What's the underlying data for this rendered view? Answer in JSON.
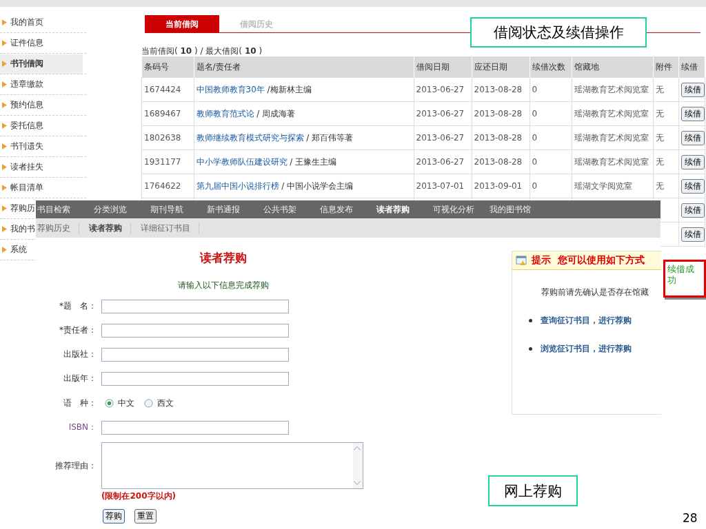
{
  "sidebar": {
    "items": [
      {
        "label": "我的首页",
        "selected": false
      },
      {
        "label": "证件信息",
        "selected": false
      },
      {
        "label": "书刊借阅",
        "selected": true
      },
      {
        "label": "违章缴款",
        "selected": false
      },
      {
        "label": "预约信息",
        "selected": false
      },
      {
        "label": "委托信息",
        "selected": false
      },
      {
        "label": "书刊遗失",
        "selected": false
      },
      {
        "label": "读者挂失",
        "selected": false
      },
      {
        "label": "帐目清单",
        "selected": false
      },
      {
        "label": "荐购历",
        "selected": false
      },
      {
        "label": "我的书",
        "selected": false
      },
      {
        "label": "系统",
        "selected": false
      }
    ]
  },
  "loan_tabs": [
    {
      "label": "当前借阅",
      "selected": true
    },
    {
      "label": "借阅历史",
      "selected": false
    }
  ],
  "callout_top": "借阅状态及续借操作",
  "loan_summary": "当前借阅( **10** ) / 最大借阅( **10** )",
  "table": {
    "columns": [
      "条码号",
      "题名/责任者",
      "借阅日期",
      "应还日期",
      "续借次数",
      "馆藏地",
      "附件",
      "续借"
    ],
    "rows": [
      {
        "barcode": "1674424",
        "title": "中国教师教育30年",
        "author": " /梅新林主编",
        "loan_date": "2013-06-27",
        "due_date": "2013-08-28",
        "renewals": "0",
        "location": "瑶湖教育艺术阅览室",
        "attachment": "无",
        "renew_button": "续借"
      },
      {
        "barcode": "1689467",
        "title": "教师教育范式论",
        "author": " / 周成海著",
        "loan_date": "2013-06-27",
        "due_date": "2013-08-28",
        "renewals": "0",
        "location": "瑶湖教育艺术阅览室",
        "attachment": "无",
        "renew_button": "续借"
      },
      {
        "barcode": "1802638",
        "title": "教师继续教育模式研究与探索",
        "author": " / 郑百伟等著",
        "loan_date": "2013-06-27",
        "due_date": "2013-08-28",
        "renewals": "0",
        "location": "瑶湖教育艺术阅览室",
        "attachment": "无",
        "renew_button": "续借"
      },
      {
        "barcode": "1931177",
        "title": "中小学教师队伍建设研究",
        "author": " / 王豫生主编",
        "loan_date": "2013-06-27",
        "due_date": "2013-08-28",
        "renewals": "0",
        "location": "瑶湖教育艺术阅览室",
        "attachment": "无",
        "renew_button": "续借"
      },
      {
        "barcode": "1764622",
        "title": "第九届中国小说排行榜",
        "author": " / 中国小说学会主编",
        "loan_date": "2013-07-01",
        "due_date": "2013-09-01",
        "renewals": "0",
        "location": "瑶湖文学阅览室",
        "attachment": "无",
        "renew_button": "续借"
      },
      {
        "renew_button": "续借"
      },
      {
        "renew_button": "续借"
      }
    ]
  },
  "opac": {
    "nav": [
      {
        "label": "书目检索",
        "selected": false
      },
      {
        "label": "分类浏览",
        "selected": false
      },
      {
        "label": "期刊导航",
        "selected": false
      },
      {
        "label": "新书通报",
        "selected": false
      },
      {
        "label": "公共书架",
        "selected": false
      },
      {
        "label": "信息发布",
        "selected": false
      },
      {
        "label": "读者荐购",
        "selected": true
      },
      {
        "label": "可视化分析",
        "selected": false
      },
      {
        "label": "我的图书馆",
        "selected": false
      }
    ],
    "subnav": [
      {
        "label": "荐购历史",
        "selected": false
      },
      {
        "label": "读者荐购",
        "selected": true
      },
      {
        "label": "详细征订书目",
        "selected": false
      }
    ],
    "title": "读者荐购",
    "subtitle": "请输入以下信息完成荐购",
    "fields": [
      {
        "kind": "text",
        "label": "*题　名："
      },
      {
        "kind": "text",
        "label": "*责任者："
      },
      {
        "kind": "text",
        "label": "出版社："
      },
      {
        "kind": "text",
        "label": "出版年："
      },
      {
        "kind": "radio",
        "label": "语　种：",
        "options": [
          {
            "label": "中文",
            "selected": true
          },
          {
            "label": "西文",
            "selected": false
          }
        ]
      },
      {
        "kind": "text",
        "label": "ISBN："
      },
      {
        "kind": "textarea",
        "label": "推荐理由："
      }
    ],
    "limit_note": "(限制在200字以内)",
    "buttons": [
      "荐购",
      "重置"
    ]
  },
  "tip": {
    "heading": "提示  您可以使用如下方式",
    "note": "荐购前请先确认是否存在馆藏",
    "links": [
      "查询征订书目，进行荐购",
      "浏览征订书目，进行荐购"
    ]
  },
  "popup": "续借成功",
  "callout_bottom": "网上荐购",
  "page_number": "28"
}
